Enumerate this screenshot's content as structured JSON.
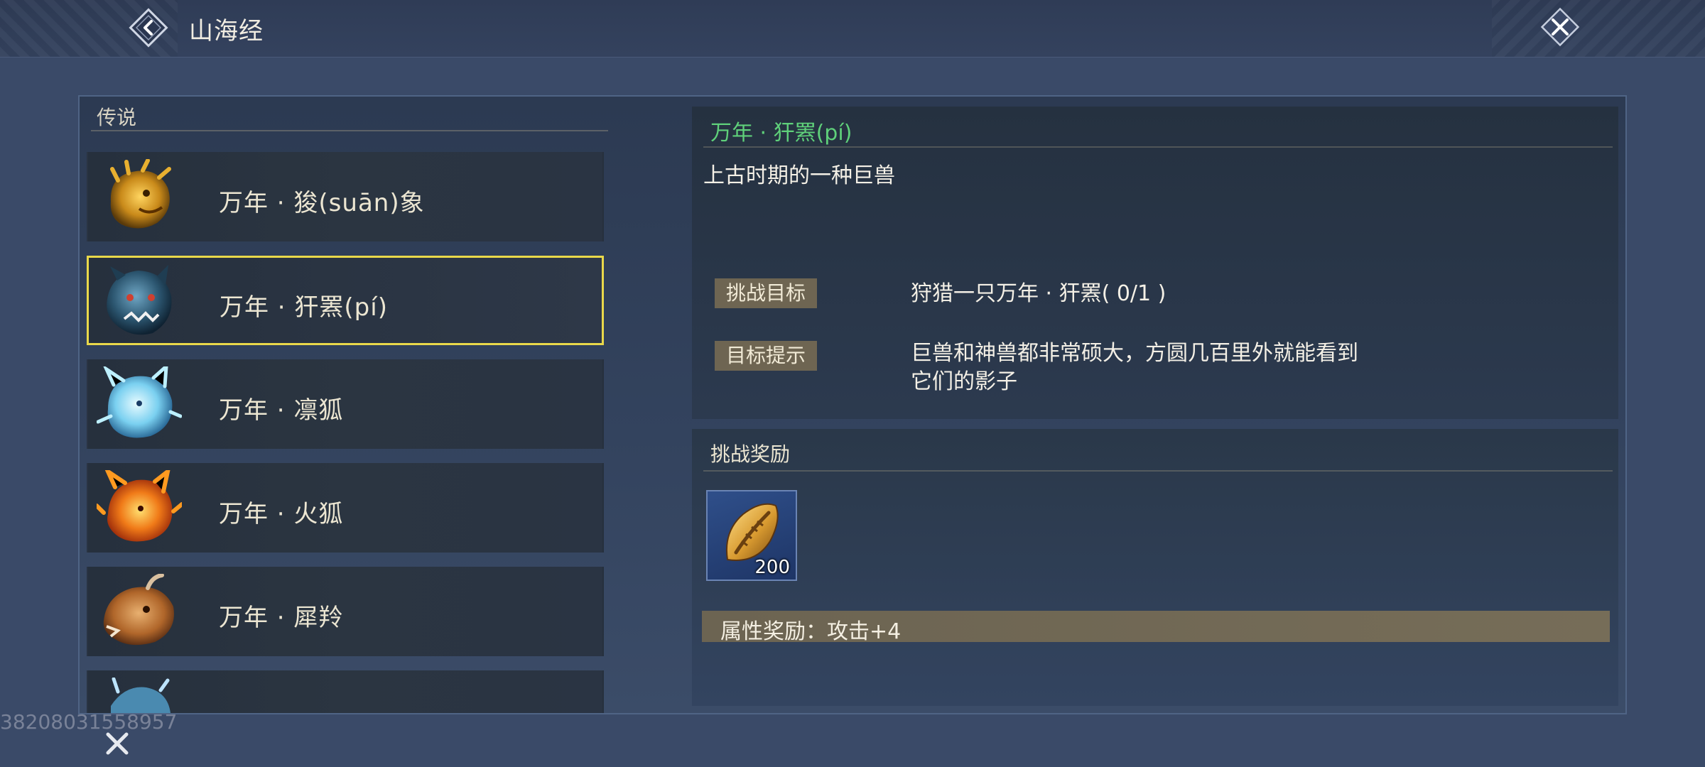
{
  "header": {
    "title": "山海经"
  },
  "left_panel": {
    "section_title": "传说",
    "items": [
      {
        "name": "万年 · 狻(suān)象",
        "icon": "golden-lion-beast-icon"
      },
      {
        "name": "万年 · 犴罴(pí)",
        "icon": "blue-wolf-bear-icon",
        "selected": true
      },
      {
        "name": "万年 · 凛狐",
        "icon": "ice-fox-icon"
      },
      {
        "name": "万年 · 火狐",
        "icon": "fire-fox-icon"
      },
      {
        "name": "万年 · 犀羚",
        "icon": "rhino-antelope-icon"
      },
      {
        "name": "",
        "icon": "ice-beast-icon"
      }
    ]
  },
  "detail": {
    "title": "万年 · 犴罴(pí)",
    "description": "上古时期的一种巨兽",
    "challenge_tag": "挑战目标",
    "challenge_text": "狩猎一只万年 · 犴罴( 0/1 )",
    "hint_tag": "目标提示",
    "hint_text": "巨兽和神兽都非常硕大，方圆几百里外就能看到它们的影子"
  },
  "rewards": {
    "title": "挑战奖励",
    "item_icon": "golden-shell-coin-icon",
    "item_count": "200",
    "attribute_text": "属性奖励：攻击+4"
  },
  "footer": {
    "watermark": "38208031558957"
  },
  "colors": {
    "accent_green": "#5fd07a",
    "selected_border": "#e9d84a",
    "tag_bg": "#6e6552"
  }
}
